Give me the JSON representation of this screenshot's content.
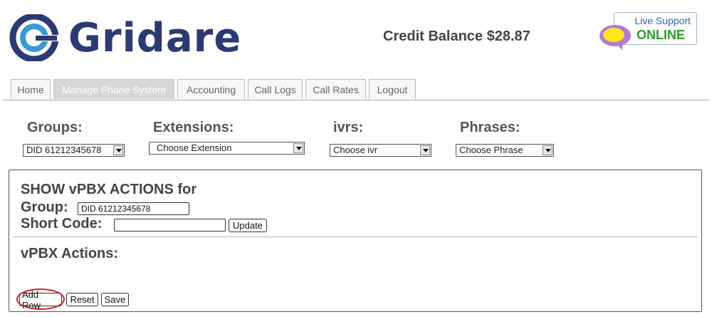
{
  "brand": {
    "name": "Gridare"
  },
  "header": {
    "credit_balance": "Credit Balance $28.87"
  },
  "support": {
    "line1": "Live Support",
    "line2": "ONLINE",
    "online_color": "#2a9d2a"
  },
  "tabs": [
    {
      "label": "Home"
    },
    {
      "label": "Manage Phone System",
      "active": true
    },
    {
      "label": "Accounting"
    },
    {
      "label": "Call Logs"
    },
    {
      "label": "Call Rates"
    },
    {
      "label": "Logout"
    }
  ],
  "selectors": {
    "groups": {
      "label": "Groups:",
      "value": "DID 61212345678"
    },
    "extensions": {
      "label": "Extensions:",
      "value": "Choose Extension"
    },
    "ivrs": {
      "label": "ivrs:",
      "value": "Choose ivr"
    },
    "phrases": {
      "label": "Phrases:",
      "value": "Choose Phrase"
    }
  },
  "panel": {
    "title": "SHOW vPBX ACTIONS for",
    "group_label": "Group:",
    "group_value": "DID 61212345678",
    "short_code_label": "Short Code:",
    "short_code_value": "",
    "update_label": "Update",
    "actions_label": "vPBX Actions:",
    "add_row_label": "Add Row",
    "reset_label": "Reset",
    "save_label": "Save"
  },
  "colors": {
    "brand": "#2b3a73",
    "highlight_circle": "#c4232b"
  },
  "icons": {
    "logo": "gridare-logo-icon",
    "support": "chat-bubble-icon",
    "dropdown": "chevron-down-icon"
  }
}
